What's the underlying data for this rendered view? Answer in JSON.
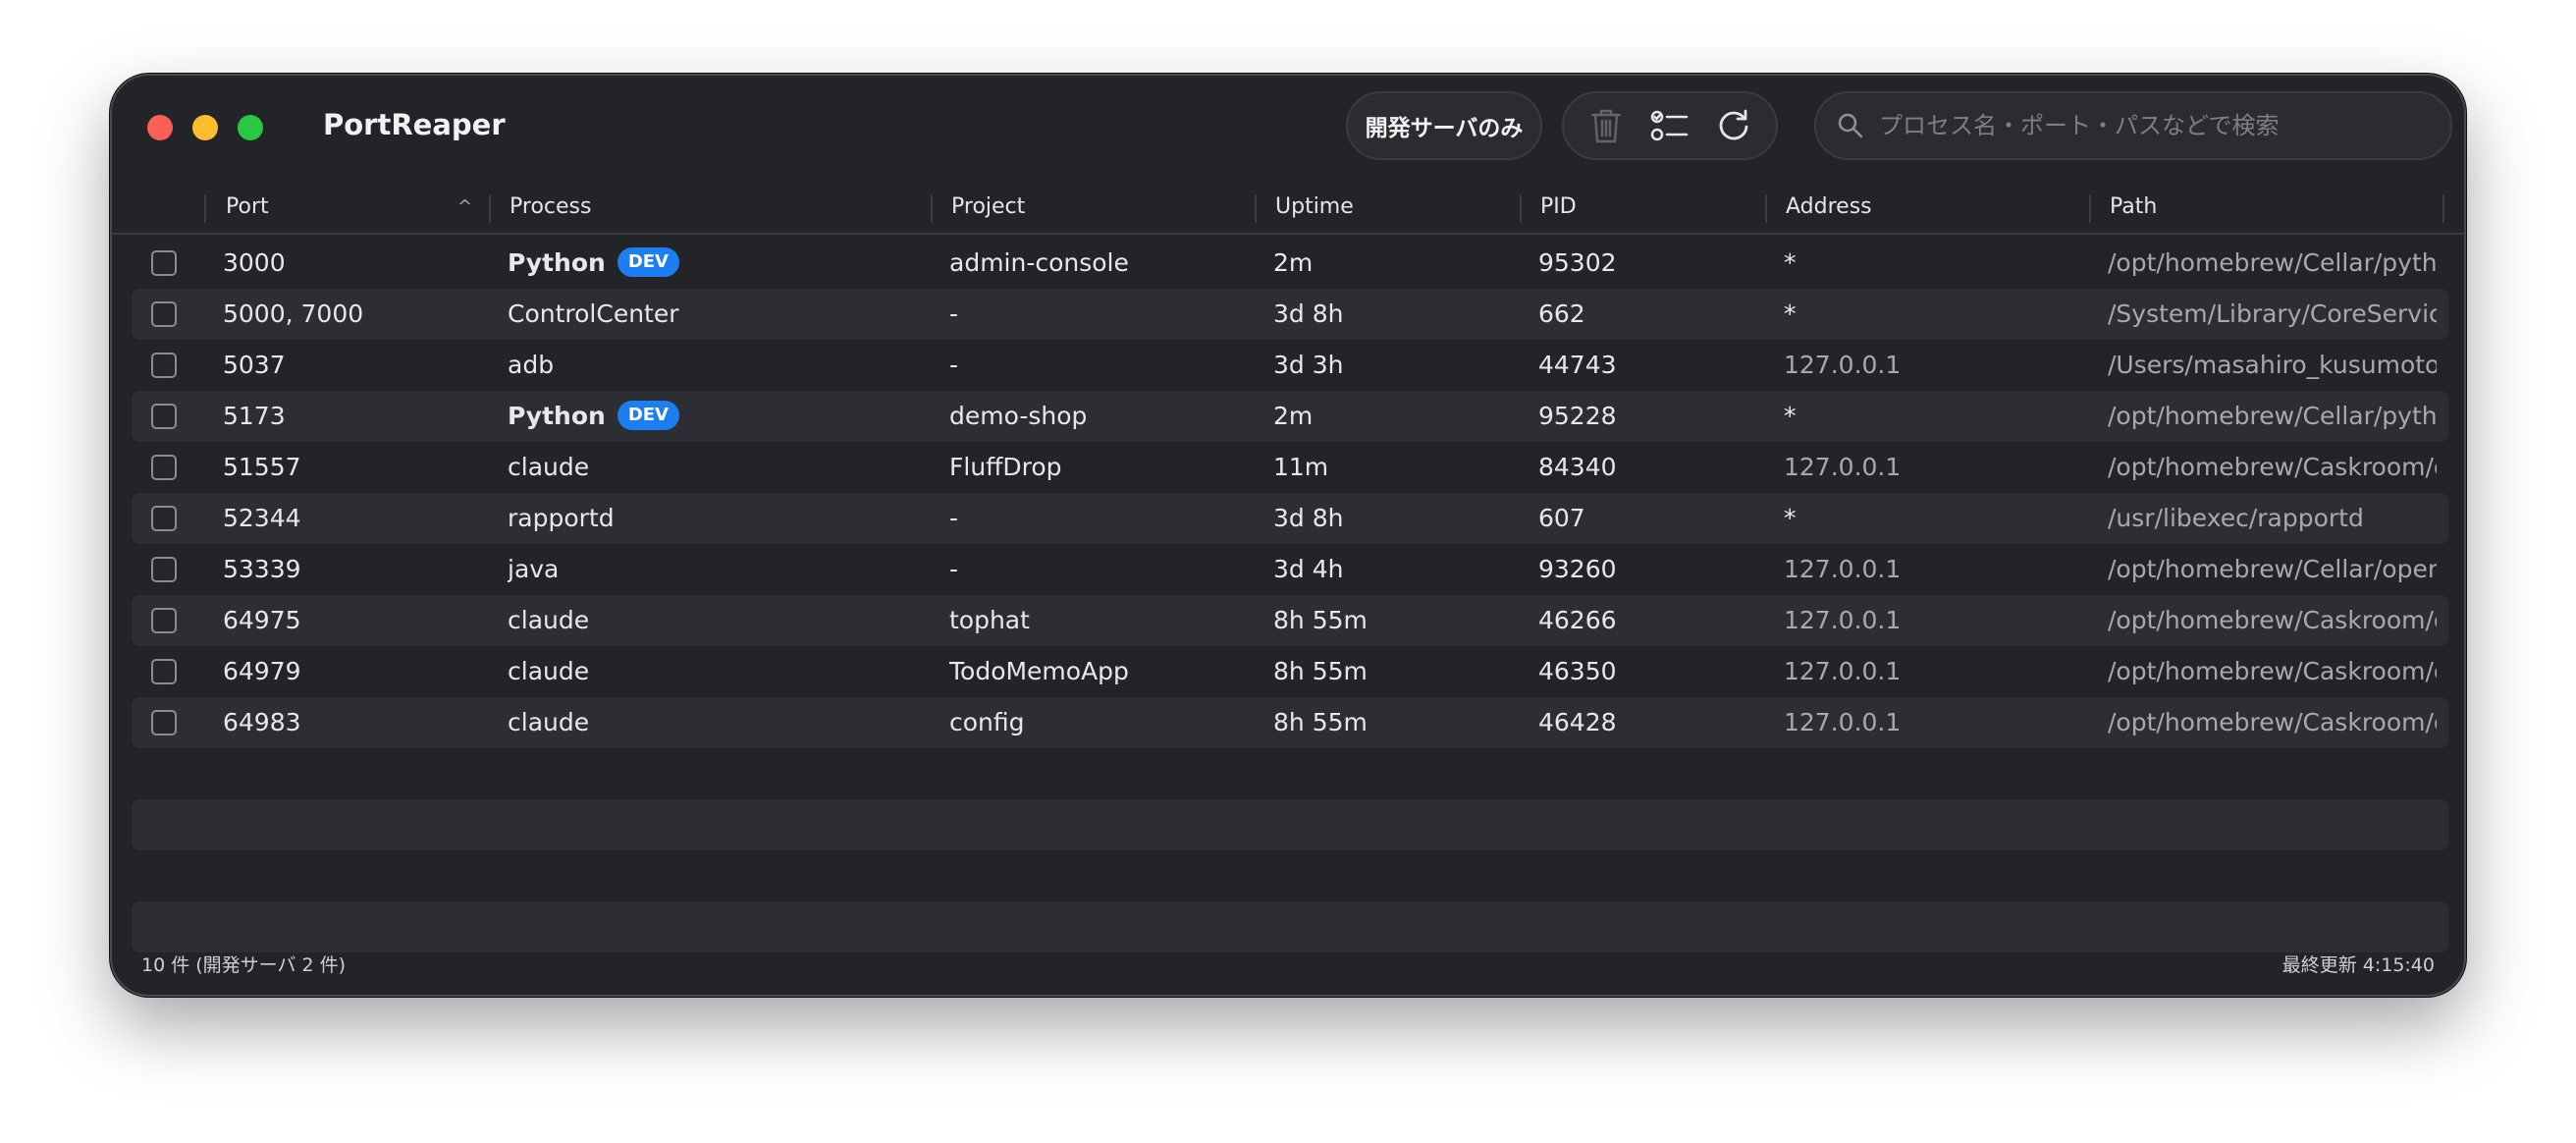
{
  "app": {
    "title": "PortReaper"
  },
  "toolbar": {
    "dev_only_label": "開発サーバのみ",
    "search_placeholder": "プロセス名・ポート・パスなどで検索"
  },
  "columns": {
    "port": "Port",
    "process": "Process",
    "project": "Project",
    "uptime": "Uptime",
    "pid": "PID",
    "address": "Address",
    "path": "Path"
  },
  "rows": [
    {
      "port": "3000",
      "process": "Python",
      "dev": true,
      "badge": "DEV",
      "project": "admin-console",
      "uptime": "2m",
      "pid": "95302",
      "address": "*",
      "path": "/opt/homebrew/Cellar/python"
    },
    {
      "port": "5000, 7000",
      "process": "ControlCenter",
      "dev": false,
      "project": "-",
      "uptime": "3d 8h",
      "pid": "662",
      "address": "*",
      "path": "/System/Library/CoreServices"
    },
    {
      "port": "5037",
      "process": "adb",
      "dev": false,
      "project": "-",
      "uptime": "3d 3h",
      "pid": "44743",
      "address": "127.0.0.1",
      "path": "/Users/masahiro_kusumoto/"
    },
    {
      "port": "5173",
      "process": "Python",
      "dev": true,
      "badge": "DEV",
      "project": "demo-shop",
      "uptime": "2m",
      "pid": "95228",
      "address": "*",
      "path": "/opt/homebrew/Cellar/python"
    },
    {
      "port": "51557",
      "process": "claude",
      "dev": false,
      "project": "FluffDrop",
      "uptime": "11m",
      "pid": "84340",
      "address": "127.0.0.1",
      "path": "/opt/homebrew/Caskroom/c"
    },
    {
      "port": "52344",
      "process": "rapportd",
      "dev": false,
      "project": "-",
      "uptime": "3d 8h",
      "pid": "607",
      "address": "*",
      "path": "/usr/libexec/rapportd"
    },
    {
      "port": "53339",
      "process": "java",
      "dev": false,
      "project": "-",
      "uptime": "3d 4h",
      "pid": "93260",
      "address": "127.0.0.1",
      "path": "/opt/homebrew/Cellar/openj"
    },
    {
      "port": "64975",
      "process": "claude",
      "dev": false,
      "project": "tophat",
      "uptime": "8h 55m",
      "pid": "46266",
      "address": "127.0.0.1",
      "path": "/opt/homebrew/Caskroom/c"
    },
    {
      "port": "64979",
      "process": "claude",
      "dev": false,
      "project": "TodoMemoApp",
      "uptime": "8h 55m",
      "pid": "46350",
      "address": "127.0.0.1",
      "path": "/opt/homebrew/Caskroom/c"
    },
    {
      "port": "64983",
      "process": "claude",
      "dev": false,
      "project": "config",
      "uptime": "8h 55m",
      "pid": "46428",
      "address": "127.0.0.1",
      "path": "/opt/homebrew/Caskroom/c"
    }
  ],
  "footer": {
    "count_text": "10 件 (開発サーバ 2 件)",
    "last_updated": "最終更新 4:15:40"
  },
  "icons": {
    "delete": "trash-icon",
    "select": "checklist-icon",
    "refresh": "refresh-icon",
    "search": "search-icon",
    "sort": "chevron-up-icon"
  },
  "colors": {
    "window_bg": "#232428",
    "accent_badge": "#1c7ef0",
    "close": "#ff5f57",
    "minimize": "#febc2e",
    "zoom": "#28c840"
  }
}
